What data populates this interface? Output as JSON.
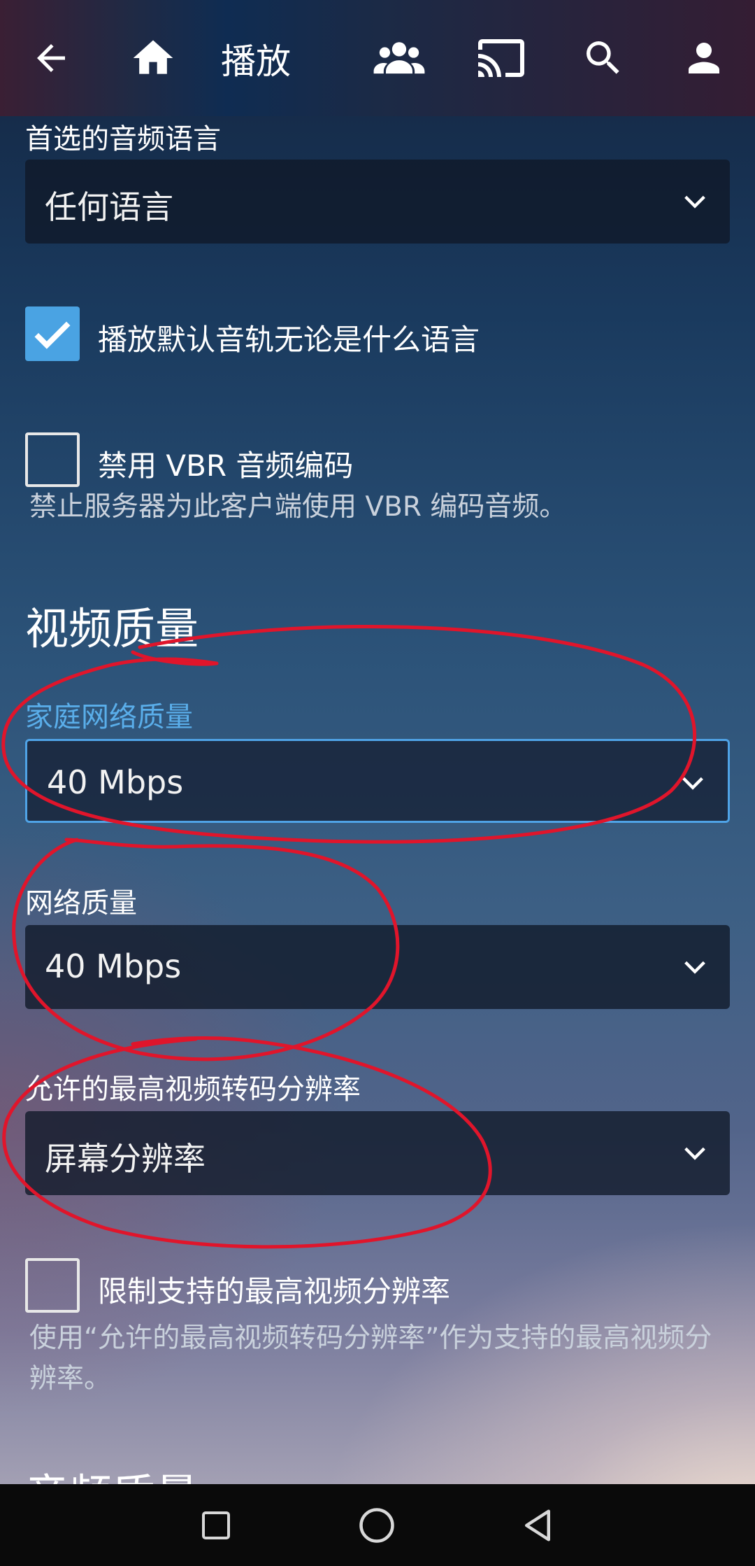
{
  "appbar": {
    "title": "播放",
    "icons": [
      "arrow-left-icon",
      "home-icon",
      "people-icon",
      "cast-icon",
      "search-icon",
      "account-icon"
    ]
  },
  "audio": {
    "preferred_language_label": "首选的音频语言",
    "preferred_language_value": "任何语言",
    "play_default_track_label": "播放默认音轨无论是什么语言",
    "play_default_track_checked": true,
    "disable_vbr_label": "禁用 VBR 音频编码",
    "disable_vbr_checked": false,
    "disable_vbr_help": "禁止服务器为此客户端使用 VBR 编码音频。"
  },
  "video": {
    "section_title": "视频质量",
    "home_quality_label": "家庭网络质量",
    "home_quality_value": "40 Mbps",
    "remote_quality_label": "网络质量",
    "remote_quality_value": "40 Mbps",
    "max_transcode_label": "允许的最高视频转码分辨率",
    "max_transcode_value": "屏幕分辨率",
    "limit_resolution_label": "限制支持的最高视频分辨率",
    "limit_resolution_checked": false,
    "limit_resolution_help": "使用“允许的最高视频转码分辨率”作为支持的最高视频分辨率。"
  },
  "next_section_title": "音频质量",
  "navbar": {
    "icons": [
      "recents-square-icon",
      "home-circle-icon",
      "back-triangle-icon"
    ]
  },
  "colors": {
    "accent": "#4aa3e3",
    "annotation": "#e0152b"
  }
}
